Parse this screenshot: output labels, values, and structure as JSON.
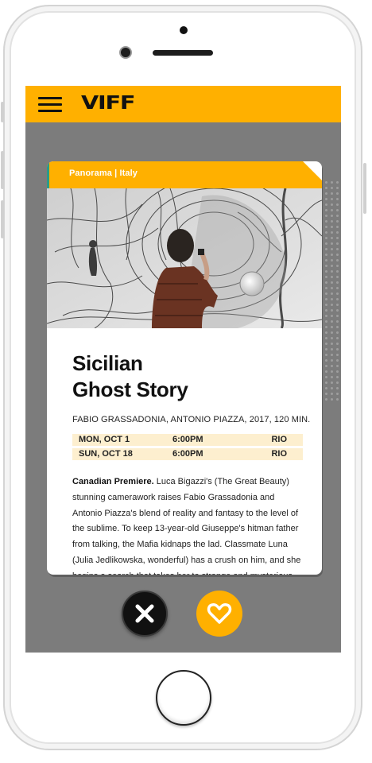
{
  "app": {
    "logo": "VIFF"
  },
  "card": {
    "category": "Panorama | Italy",
    "title_lines": [
      "Sicilian",
      "Ghost Story"
    ],
    "credits": "FABIO GRASSADONIA, ANTONIO PIAZZA, 2017, 120 MIN.",
    "showtimes": [
      {
        "date": "MON, OCT 1",
        "time": "6:00PM",
        "venue": "RIO"
      },
      {
        "date": "SUN, OCT 18",
        "time": "6:00PM",
        "venue": "RIO"
      }
    ],
    "synopsis_lead": "Canadian Premiere.",
    "synopsis_body": " Luca Bigazzi's (The Great Beauty) stunning camerawork raises Fabio Grassadonia and Antonio Piazza's blend of reality and fantasy to the level of the sublime. To keep 13-year-old Giuseppe's hitman father from talking, the Mafia kidnaps the lad. Classmate Luna (Julia Jedlikowska, wonderful) has a crush on him, and she begins a search that takes her to strange and mysterious places."
  },
  "actions": {
    "dismiss_icon": "close-icon",
    "like_icon": "heart-icon"
  },
  "icons": {
    "menu": "hamburger-menu-icon"
  },
  "colors": {
    "brand": "#ffb000",
    "screen_bg": "#7c7c7c",
    "showtime_bg": "#fdefcf",
    "tab_edge": "#2b9b87"
  }
}
